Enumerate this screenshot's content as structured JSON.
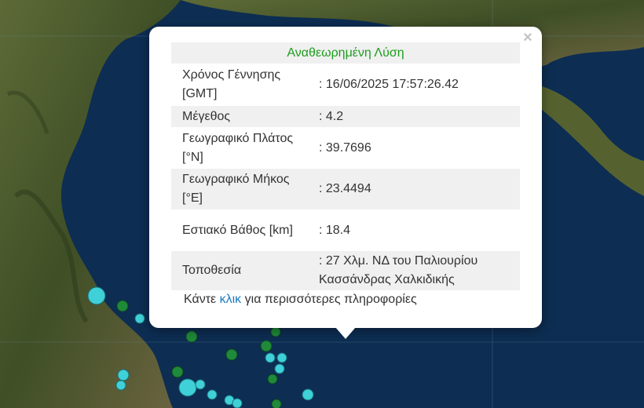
{
  "popup": {
    "title": "Αναθεωρημένη Λύση",
    "close_symbol": "×",
    "rows": [
      {
        "label": "Χρόνος Γέννησης [GMT]",
        "value": ": 16/06/2025 17:57:26.42"
      },
      {
        "label": "Μέγεθος",
        "value": ": 4.2"
      },
      {
        "label": "Γεωγραφικό Πλάτος [°N]",
        "value": ": 39.7696"
      },
      {
        "label": "Γεωγραφικό Μήκος [°E]",
        "value": ": 23.4494"
      },
      {
        "label": "Εστιακό Βάθος [km]",
        "value": ": 18.4"
      },
      {
        "label": "Τοποθεσία",
        "value": ": 27 Χλμ. ΝΔ του Παλιουρίου Κασσάνδρας Χαλκιδικής"
      }
    ],
    "footer_prefix": "Κάντε ",
    "footer_link": "κλικ",
    "footer_suffix": " για περισσότερες πληροφορίες"
  },
  "colors": {
    "sea": "#0d2d52",
    "land": "#4b5a2c",
    "title_green": "#1e9d1e",
    "link_blue": "#1a7bbf",
    "marker_green": "#1f8a3a",
    "marker_cyan": "#3fd0d8"
  }
}
